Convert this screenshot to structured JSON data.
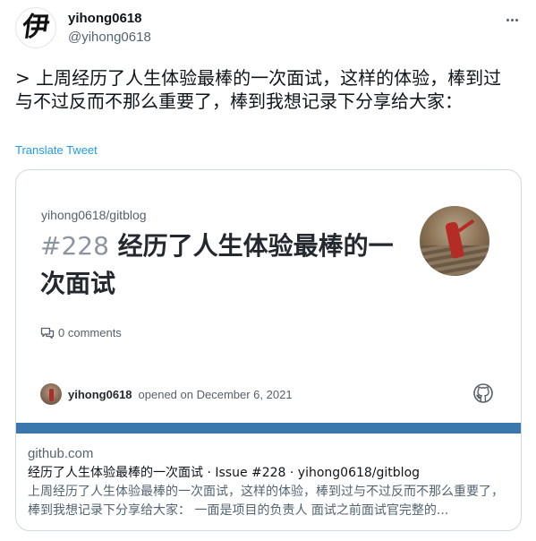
{
  "tweet": {
    "avatar_glyph": "伊",
    "display_name": "yihong0618",
    "handle": "@yihong0618",
    "text": "> 上周经历了人生体验最棒的一次面试，这样的体验，棒到过与不过反而不那么重要了，棒到我想记录下分享给大家：",
    "translate_label": "Translate Tweet",
    "icons": {
      "more": "more-horizontal-icon"
    }
  },
  "card": {
    "preview": {
      "repo": "yihong0618/gitblog",
      "issue_number": "#228",
      "issue_title": "经历了人生体验最棒的一次面试",
      "comments": "0 comments",
      "author": "yihong0618",
      "opened_text": "opened on December 6, 2021"
    },
    "domain": "github.com",
    "title": "经历了人生体验最棒的一次面试 · Issue #228 · yihong0618/gitblog",
    "description": "上周经历了人生体验最棒的一次面试，这样的体验，棒到过与不过反而不那么重要了，棒到我想记录下分享给大家： 一面是项目的负责人 面试之前面试官完整的...",
    "accent_color": "#3b76ad"
  },
  "colors": {
    "link": "#1d9bf0",
    "secondary_text": "#536471"
  }
}
